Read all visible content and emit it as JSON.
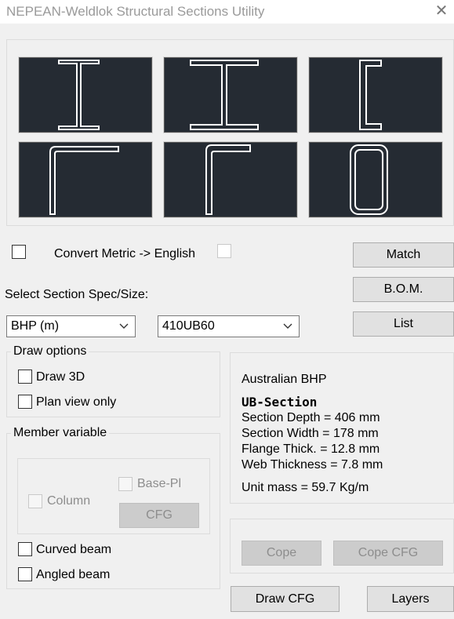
{
  "window": {
    "title": "NEPEAN-Weldlok Structural Sections Utility",
    "close_glyph": "✕"
  },
  "palette": {
    "tiles": [
      {
        "name": "i-beam"
      },
      {
        "name": "wide-flange-beam"
      },
      {
        "name": "channel"
      },
      {
        "name": "equal-angle"
      },
      {
        "name": "unequal-angle"
      },
      {
        "name": "rectangular-hollow"
      }
    ]
  },
  "units": {
    "convert_label": "Convert Metric -> English",
    "convert_checked": false
  },
  "section": {
    "select_label": "Select Section Spec/Size:",
    "spec_value": "BHP (m)",
    "size_value": "410UB60"
  },
  "buttons": {
    "match": "Match",
    "bom": "B.O.M.",
    "list": "List",
    "cfg": "CFG",
    "cope": "Cope",
    "cope_cfg": "Cope CFG",
    "draw_cfg": "Draw CFG",
    "layers": "Layers"
  },
  "draw_options": {
    "title": "Draw options",
    "draw3d": "Draw 3D",
    "plan_view": "Plan view only"
  },
  "member_variable": {
    "title": "Member variable",
    "column": "Column",
    "base_pl": "Base-Pl",
    "curved_beam": "Curved beam",
    "angled_beam": "Angled beam"
  },
  "info": {
    "spec": "Australian BHP",
    "section_type": "UB-Section",
    "depth": "Section Depth = 406 mm",
    "width": "Section Width = 178 mm",
    "flange": "Flange Thick. = 12.8 mm",
    "web": "Web Thickness = 7.8 mm",
    "mass": "Unit mass = 59.7 Kg/m"
  }
}
